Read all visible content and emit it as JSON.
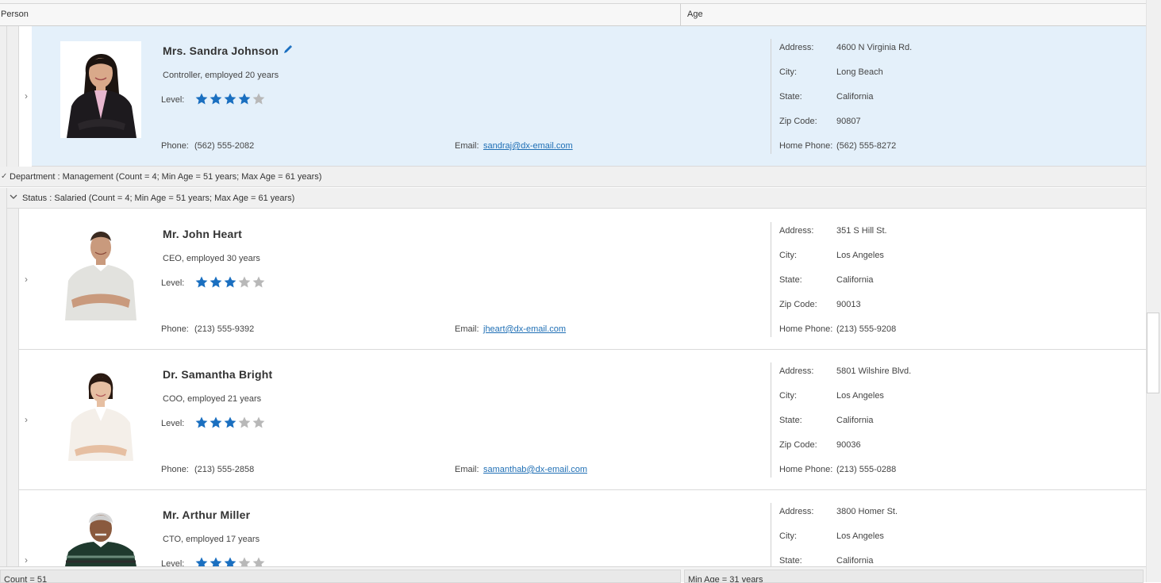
{
  "columns": {
    "person": "Person",
    "age": "Age"
  },
  "groups": {
    "department": "Department : Management (Count = 4; Min Age = 51 years; Max Age = 61 years)",
    "status": "Status : Salaried (Count = 4; Min Age = 51 years; Max Age = 61 years)"
  },
  "labels": {
    "level": "Level:",
    "phone": "Phone:",
    "email": "Email:",
    "address": "Address:",
    "city": "City:",
    "state": "State:",
    "zip": "Zip Code:",
    "home_phone": "Home Phone:"
  },
  "colors": {
    "selected_row": "#e4f0fa",
    "star_filled": "#1a6fc0",
    "star_empty": "#b8b8b8",
    "link": "#1f6fb5"
  },
  "people": [
    {
      "name": "Mrs. Sandra Johnson",
      "title": "Controller, employed 20 years",
      "level": 4,
      "level_max": 5,
      "phone": "(562) 555-2082",
      "email": "sandraj@dx-email.com",
      "address": "4600 N Virginia Rd.",
      "city": "Long Beach",
      "state": "California",
      "zip": "90807",
      "home_phone": "(562) 555-8272",
      "selected": true,
      "edit_icon": "pencil-icon"
    },
    {
      "name": "Mr. John Heart",
      "title": "CEO, employed 30 years",
      "level": 3,
      "level_max": 5,
      "phone": "(213) 555-9392",
      "email": "jheart@dx-email.com",
      "address": "351 S Hill St.",
      "city": "Los Angeles",
      "state": "California",
      "zip": "90013",
      "home_phone": "(213) 555-9208"
    },
    {
      "name": "Dr. Samantha Bright",
      "title": "COO, employed 21 years",
      "level": 3,
      "level_max": 5,
      "phone": "(213) 555-2858",
      "email": "samanthab@dx-email.com",
      "address": "5801 Wilshire Blvd.",
      "city": "Los Angeles",
      "state": "California",
      "zip": "90036",
      "home_phone": "(213) 555-0288"
    },
    {
      "name": "Mr. Arthur Miller",
      "title": "CTO, employed 17 years",
      "level": 3,
      "level_max": 5,
      "address": "3800 Homer St.",
      "city": "Los Angeles",
      "state": "California"
    }
  ],
  "footer": {
    "count": "Count = 51",
    "min_age": "Min Age = 31 years"
  }
}
